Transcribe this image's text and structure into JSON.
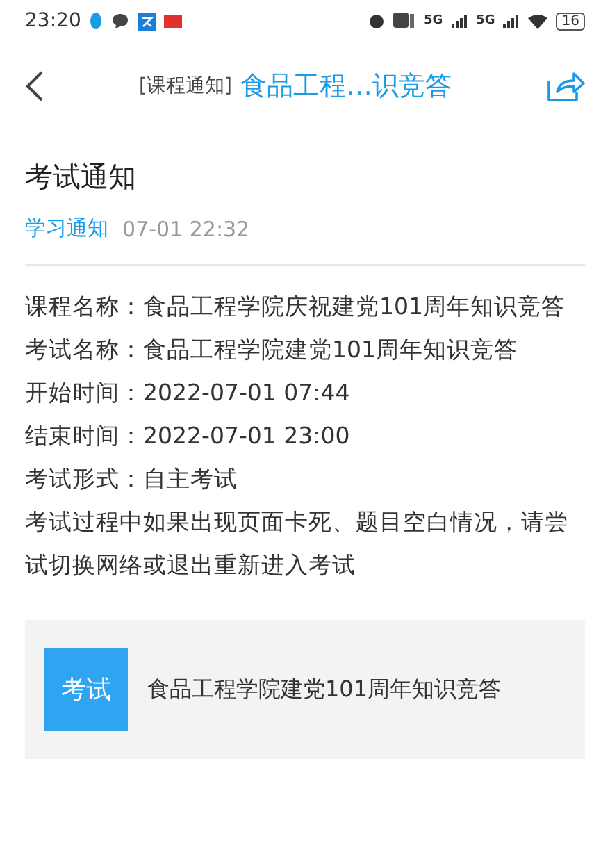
{
  "status_bar": {
    "time": "23:20",
    "network_1": "5G",
    "network_2": "5G",
    "battery": "16"
  },
  "header": {
    "category": "[课程通知]",
    "title": "食品工程…识竞答"
  },
  "notice": {
    "title": "考试通知",
    "tag": "学习通知",
    "time": "07-01 22:32",
    "lines": [
      "课程名称：食品工程学院庆祝建党101周年知识竞答",
      "考试名称：食品工程学院建党101周年知识竞答",
      "开始时间：2022-07-01 07:44",
      "结束时间：2022-07-01 23:00",
      "考试形式：自主考试",
      "考试过程中如果出现页面卡死、题目空白情况，请尝试切换网络或退出重新进入考试"
    ]
  },
  "card": {
    "badge": "考试",
    "title": "食品工程学院建党101周年知识竞答"
  }
}
